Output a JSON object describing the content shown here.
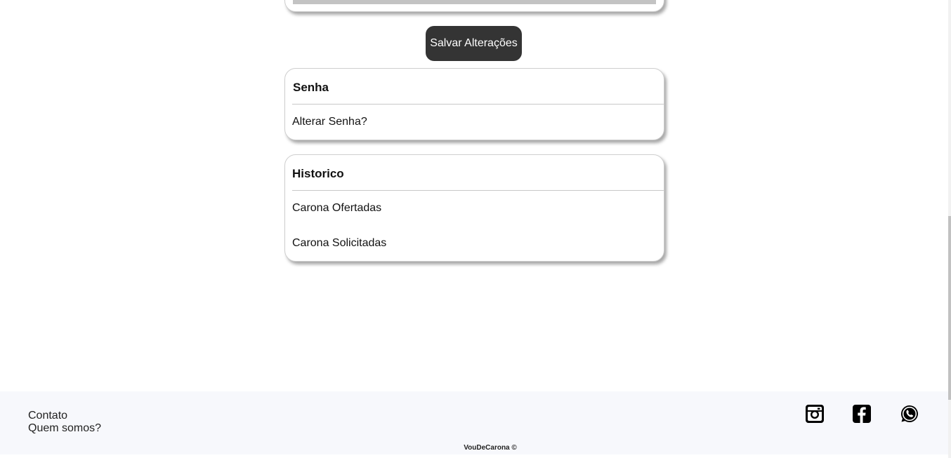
{
  "actions": {
    "save_label": "Salvar Alterações"
  },
  "senha": {
    "title": "Senha",
    "change_password": "Alterar Senha?"
  },
  "historico": {
    "title": "Historico",
    "items": [
      "Carona Ofertadas",
      "Carona Solicitadas"
    ]
  },
  "footer": {
    "links": [
      "Contato",
      "Quem somos?"
    ],
    "copyright": "VouDeCarona ©",
    "social_icons": [
      "instagram-icon",
      "facebook-icon",
      "whatsapp-icon"
    ]
  },
  "colors": {
    "button_bg": "#343434",
    "footer_bg": "#f7f8fc"
  }
}
